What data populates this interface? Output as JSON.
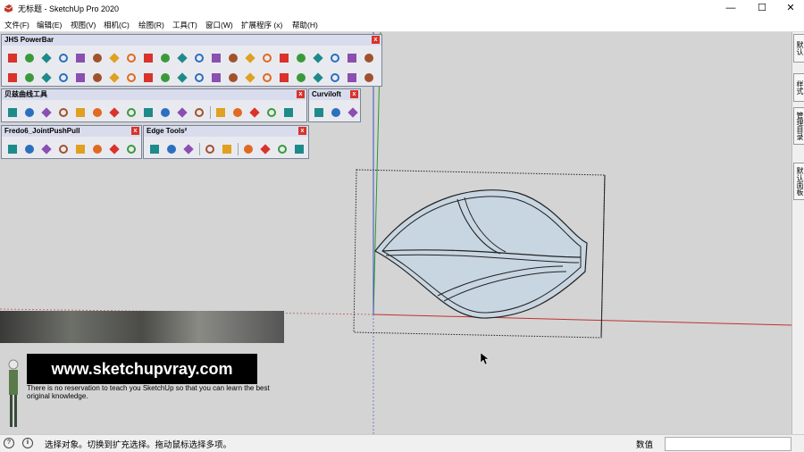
{
  "window": {
    "title": "无标题 - SketchUp Pro 2020",
    "minimize": "—",
    "maximize": "☐",
    "close": "✕"
  },
  "menu": [
    "文件(F)",
    "编辑(E)",
    "视图(V)",
    "相机(C)",
    "绘图(R)",
    "工具(T)",
    "窗口(W)",
    "扩展程序 (x)",
    "帮助(H)"
  ],
  "toolbars": {
    "jhs": {
      "title": "JHS PowerBar"
    },
    "bezier": {
      "title": "贝兹曲线工具"
    },
    "curviloft": {
      "title": "Curviloft"
    },
    "fredo": {
      "title": "Fredo6_JointPushPull"
    },
    "edge": {
      "title": "Edge Tools²"
    },
    "close_glyph": "x"
  },
  "side_tabs": [
    "默认",
    "样式",
    "管理目录",
    "默认面板"
  ],
  "watermark": {
    "site": "www.sketchupvray.com",
    "tagline": "There is no reservation to teach you SketchUp so that you can learn the best original knowledge."
  },
  "status": {
    "message": "选择对象。切换到扩充选择。拖动鼠标选择多项。",
    "measure_label": "数值",
    "measure_value": ""
  },
  "colors": {
    "accent_red": "#d9332b",
    "axis_red": "#c03030",
    "axis_green": "#2a9a2a",
    "axis_blue": "#3a4fc0",
    "leaf_fill": "#c8d6e2"
  },
  "icons": [
    "app-icon",
    "close-icon",
    "geo-location-icon",
    "info-icon",
    "cursor-icon",
    "scale-figure-icon"
  ]
}
